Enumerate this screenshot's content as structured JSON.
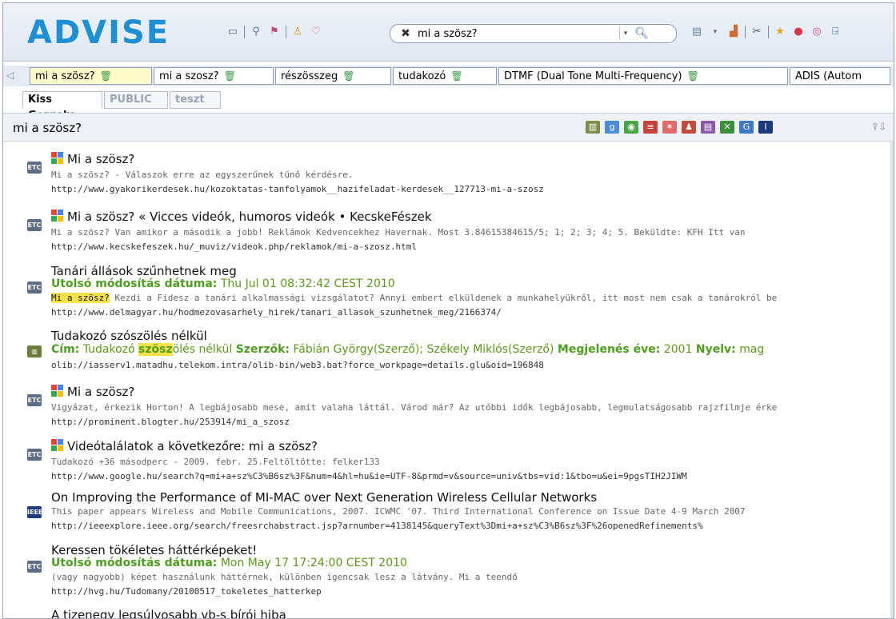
{
  "brand": {
    "logo": "ADVISE"
  },
  "search": {
    "value": "mi a szösz?"
  },
  "tabs": [
    {
      "label": "mi a szösz?"
    },
    {
      "label": "mi a szosz?"
    },
    {
      "label": "részösszeg"
    },
    {
      "label": "tudakozó"
    },
    {
      "label": "DTMF (Dual Tone Multi-Frequency)"
    },
    {
      "label": "ADIS (Autom"
    }
  ],
  "subtabs": [
    {
      "label": "Kiss Gergely"
    },
    {
      "label": "PUBLIC"
    },
    {
      "label": "teszt"
    }
  ],
  "query": {
    "text": "mi a szösz?"
  },
  "results": [
    {
      "title": "Mi a szösz?",
      "snippet": "Mi a szösz? - Válaszok erre az egyszerűnek tűnő kérdésre.",
      "url": "http://www.gyakorikerdesek.hu/kozoktatas-tanfolyamok__hazifeladat-kerdesek__127713-mi-a-szosz"
    },
    {
      "title": "Mi a szösz? « Vicces videók, humoros videók • KecskeFészek",
      "snippet": "Mi a szösz? Van amikor a második a jobb! Reklámok Kedvencekhez Havernak. Most 3.84615384615/5; 1; 2; 3; 4; 5. Beküldte: KFH Itt van",
      "url": "http://www.kecskefeszek.hu/_muviz/videok.php/reklamok/mi-a-szosz.html"
    },
    {
      "title": "Tanári állások szűnhetnek meg",
      "meta_label": "Utolsó módosítás dátuma:",
      "meta_value": "Thu Jul 01 08:32:42 CEST 2010",
      "snippet_hl": "Mi a szösz?",
      "snippet": " Kezdi a Fidesz a tanári alkalmassági vizsgálatot? Annyi embert elküldenek a munkahelyükről, itt most nem csak a tanárokról be",
      "url": "http://www.delmagyar.hu/hodmezovasarhely_hirek/tanari_allasok_szunhetnek_meg/2166374/"
    },
    {
      "title": "Tudakozó szószölés nélkül",
      "cim_label": "Cím:",
      "cim_pre": "Tudakozó ",
      "cim_hl": "szösz",
      "cim_post": "ölés nélkül",
      "szerzok_label": "Szerzők:",
      "szerzok": "Fábián György(Szerző); Székely Miklós(Szerző)",
      "ev_label": "Megjelenés éve:",
      "ev": "2001",
      "nyelv_label": "Nyelv:",
      "nyelv": "mag",
      "url": "olib://iasserv1.matadhu.telekom.intra/olib-bin/web3.bat?force_workpage=details.glu&oid=196848"
    },
    {
      "title": "Mi a szösz?",
      "snippet": "Vigyázat, érkezik Horton! A legbájosabb mese, amit valaha láttál. Várod már? Az utóbbi idők legbájosabb, legmulatságosabb rajzfilmje érke",
      "url": "http://prominent.blogter.hu/253914/mi_a_szosz"
    },
    {
      "title": "Videótalálatok a következőre: mi a szösz?",
      "snippet": "Tudakozó +36 másodperc - 2009. febr. 25.Feltöltötte: felker133",
      "url": "http://www.google.hu/search?q=mi+a+sz%C3%B6sz%3F&num=4&hl=hu&ie=UTF-8&prmd=v&source=univ&tbs=vid:1&tbo=u&ei=9pgsTIH2JIWM"
    },
    {
      "title": "On Improving the Performance of MI-MAC over Next Generation Wireless Cellular Networks",
      "snippet": "This paper appears Wireless and Mobile Communications, 2007. ICWMC '07. Third International Conference on Issue Date   4-9 March 2007",
      "url": "http://ieeexplore.ieee.org/search/freesrchabstract.jsp?arnumber=4138145&queryText%3Dmi+a+sz%C3%B6sz%3F%26openedRefinements%"
    },
    {
      "title": "Keressen tökéletes háttérképeket!",
      "meta_label": "Utolsó módosítás dátuma:",
      "meta_value": "Mon May 17 17:24:00 CEST 2010",
      "snippet": "(vagy nagyobb) képet használunk háttérnek, különben igencsak lesz a látvány. Mi a teendő",
      "url": "http://hvg.hu/Tudomany/20100517_tokeletes_hatterkep"
    },
    {
      "title": "A tizenegy legsúlyosabb vb-s bírói hiba"
    }
  ]
}
